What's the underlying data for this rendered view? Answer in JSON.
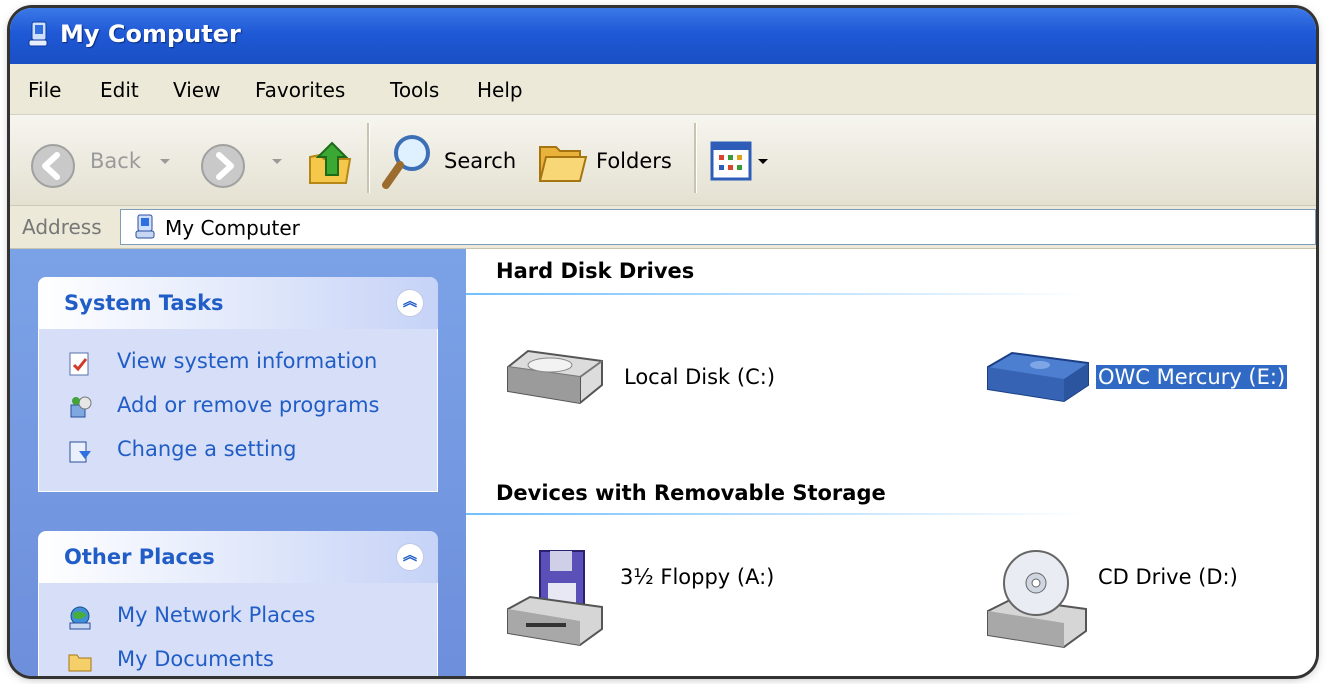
{
  "window": {
    "title": "My Computer"
  },
  "menu": [
    "File",
    "Edit",
    "View",
    "Favorites",
    "Tools",
    "Help"
  ],
  "toolbar": {
    "back_label": "Back",
    "search_label": "Search",
    "folders_label": "Folders"
  },
  "address": {
    "label": "Address",
    "value": "My Computer"
  },
  "system_tasks": {
    "title": "System Tasks",
    "items": [
      {
        "label": "View system information",
        "icon": "system-info-icon"
      },
      {
        "label": "Add or remove programs",
        "icon": "add-remove-icon"
      },
      {
        "label": "Change a setting",
        "icon": "control-panel-icon"
      }
    ]
  },
  "other_places": {
    "title": "Other Places",
    "items": [
      {
        "label": "My Network Places",
        "icon": "network-icon"
      },
      {
        "label": "My Documents",
        "icon": "folder-icon"
      }
    ]
  },
  "hard_disks": {
    "title": "Hard Disk Drives",
    "items": [
      {
        "label": "Local Disk (C:)",
        "selected": false
      },
      {
        "label": "OWC Mercury (E:)",
        "selected": true
      }
    ]
  },
  "removable": {
    "title": "Devices with Removable Storage",
    "items": [
      {
        "label": "3½ Floppy (A:)"
      },
      {
        "label": "CD Drive (D:)"
      }
    ]
  },
  "colors": {
    "title_bar": "#1f59d6",
    "task_link": "#215dc6",
    "selection": "#316ac5"
  }
}
